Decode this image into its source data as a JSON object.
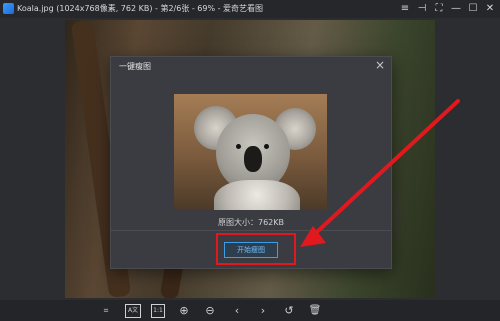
{
  "window": {
    "title": "Koala.jpg (1024x768像素, 762 KB) - 第2/6张 - 69% - 爱奇艺看图"
  },
  "titlebar_icons": {
    "menu": "menu-icon",
    "pin": "pin-icon",
    "fullscreen": "fullscreen-icon",
    "minimize": "minimize-icon",
    "maximize": "maximize-icon",
    "close": "close-icon"
  },
  "dialog": {
    "title": "一键瘦图",
    "close_glyph": "×",
    "size_label": "原图大小：762KB",
    "start_button": "开始瘦图"
  },
  "toolbar": {
    "items": [
      {
        "name": "crop-icon",
        "glyph": "⌗"
      },
      {
        "name": "ocr-icon",
        "glyph": "A文"
      },
      {
        "name": "actual-size-icon",
        "glyph": "1:1"
      },
      {
        "name": "zoom-in-icon",
        "glyph": "⊕"
      },
      {
        "name": "zoom-out-icon",
        "glyph": "⊖"
      },
      {
        "name": "prev-icon",
        "glyph": "‹"
      },
      {
        "name": "next-icon",
        "glyph": "›"
      },
      {
        "name": "rotate-icon",
        "glyph": "↺"
      },
      {
        "name": "delete-icon",
        "glyph": "🗑"
      }
    ]
  },
  "colors": {
    "accent": "#3d9ee8",
    "annotation": "#e1191e"
  }
}
